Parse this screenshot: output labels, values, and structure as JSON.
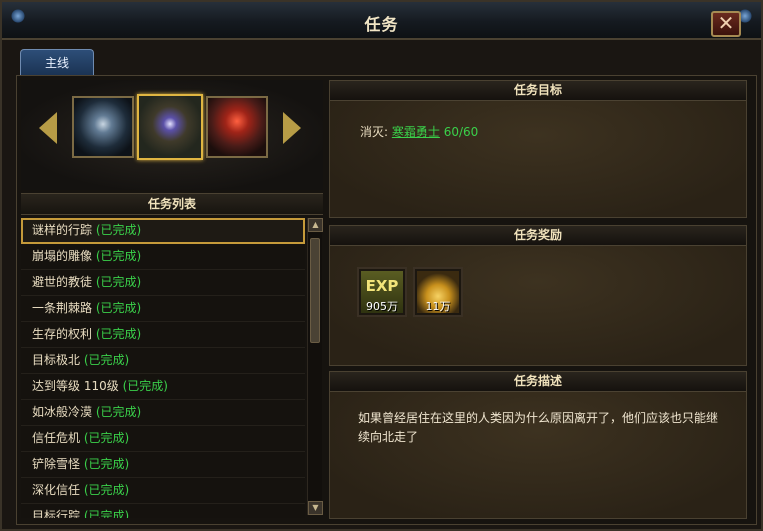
{
  "window": {
    "title": "任务",
    "close_label": "✕"
  },
  "tabs": [
    {
      "label": "主线"
    }
  ],
  "left": {
    "list_header": "任务列表",
    "quests": [
      {
        "name": "谜样的行踪",
        "status": "(已完成)"
      },
      {
        "name": "崩塌的雕像",
        "status": "(已完成)"
      },
      {
        "name": "避世的教徒",
        "status": "(已完成)"
      },
      {
        "name": "一条荆棘路",
        "status": "(已完成)"
      },
      {
        "name": "生存的权利",
        "status": "(已完成)"
      },
      {
        "name": "目标极北",
        "status": "(已完成)"
      },
      {
        "name": "达到等级 110级",
        "status": "(已完成)"
      },
      {
        "name": "如冰般冷漠",
        "status": "(已完成)"
      },
      {
        "name": "信任危机",
        "status": "(已完成)"
      },
      {
        "name": "铲除雪怪",
        "status": "(已完成)"
      },
      {
        "name": "深化信任",
        "status": "(已完成)"
      },
      {
        "name": "目标行踪",
        "status": "(已完成)"
      }
    ],
    "scroll_up": "▲",
    "scroll_down": "▼"
  },
  "goal": {
    "header": "任务目标",
    "prefix": "消灭:",
    "target": "寒霜勇士",
    "count": "60/60"
  },
  "reward": {
    "header": "任务奖励",
    "items": [
      {
        "icon": "exp-icon",
        "icon_text": "EXP",
        "amount": "905万"
      },
      {
        "icon": "gold-coins-icon",
        "amount": "11万"
      }
    ]
  },
  "description": {
    "header": "任务描述",
    "text": "如果曾经居住在这里的人类因为什么原因离开了，他们应该也只能继续向北走了"
  },
  "colors": {
    "accent_gold": "#e0b642",
    "complete_green": "#3ad04a",
    "tab_blue": "#2d4e78"
  }
}
